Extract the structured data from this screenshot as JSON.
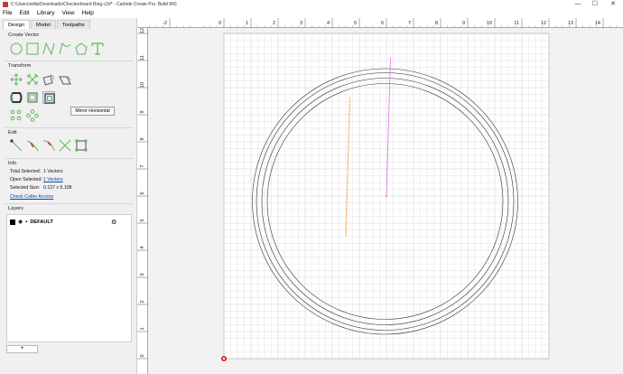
{
  "window": {
    "title": "C:\\Users\\willa\\Downloads\\Checkerboard Ring.c2d* - Carbide Create Pro. Build 843",
    "minimize": "—",
    "maximize": "☐",
    "close": "✕"
  },
  "menu": [
    "File",
    "Edit",
    "Library",
    "View",
    "Help"
  ],
  "tabs": [
    "Design",
    "Model",
    "Toolpaths"
  ],
  "sections": {
    "create_vector": "Create Vector",
    "transform": "Transform",
    "edit": "Edit",
    "info": "Info",
    "layers": "Layers"
  },
  "tooltip": "Mirror Horizontal",
  "info": {
    "total_selected_label": "Total Selected:",
    "total_selected_value": "1 Vectors",
    "open_selected_label": "Open Selected:",
    "open_selected_value": "1 Vectors",
    "selected_size_label": "Selected Size:",
    "selected_size_value": "0.127 x 5.108",
    "check_cutter": "Check Cutter Access"
  },
  "layers": [
    {
      "name": "DEFAULT",
      "color": "#000000"
    }
  ],
  "add_layer_label": "+",
  "ruler": {
    "x_labels": [
      "-2",
      "0",
      "1",
      "2",
      "3",
      "4",
      "5",
      "6",
      "7",
      "8",
      "9",
      "10",
      "11",
      "12",
      "13",
      "14"
    ],
    "y_labels": [
      "12",
      "11",
      "10",
      "9",
      "8",
      "7",
      "6",
      "5",
      "4",
      "3",
      "2",
      "1",
      "0"
    ]
  },
  "colors": {
    "accent_icon": "#5cb85c",
    "orange_vector": "#f0a040",
    "magenta_vector": "#e070e0",
    "circle": "#333333",
    "grid": "#d6d6d6",
    "origin_marker": "#e02020"
  },
  "icons": {
    "create_vector": [
      "circle-icon",
      "rectangle-icon",
      "polyline-icon",
      "curve-icon",
      "polygon-icon",
      "text-icon"
    ],
    "transform": [
      "move-icon",
      "scale-icon",
      "rotate-icon",
      "skew-icon",
      "mirror-vertical-icon",
      "mirror-horizontal-icon",
      "offset-icon",
      "align-icon",
      "array-icon",
      "circular-array-icon"
    ],
    "edit": [
      "node-edit-icon",
      "trim-icon",
      "fillet-icon",
      "cut-icon",
      "bounding-box-icon"
    ]
  }
}
